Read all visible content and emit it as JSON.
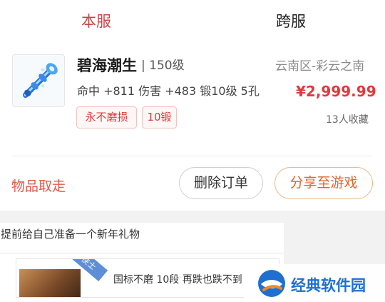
{
  "tabs": {
    "local": "本服",
    "cross": "跨服"
  },
  "item": {
    "name": "碧海潮生",
    "level": "| 150级",
    "server": "云南区-彩云之南",
    "stats": "命中 +811 伤害 +483 锻10级 5孔",
    "price": "¥2,999.99",
    "tags": [
      "永不磨损",
      "10锻"
    ],
    "favorites": "13人收藏",
    "icon": "blue-staff-weapon-icon"
  },
  "actions": {
    "pickup": "物品取走",
    "delete": "删除订单",
    "share": "分享至游戏"
  },
  "promo": {
    "title": "提前给自己准备一个新年礼物",
    "ribbon": "侠士",
    "item_text": "国标不磨 10段 再跌也跌不到"
  },
  "watermark": {
    "text": "经典软件园"
  },
  "colors": {
    "accent": "#e03a3a",
    "share": "#e0652e",
    "watermark": "#1f6fd1"
  }
}
